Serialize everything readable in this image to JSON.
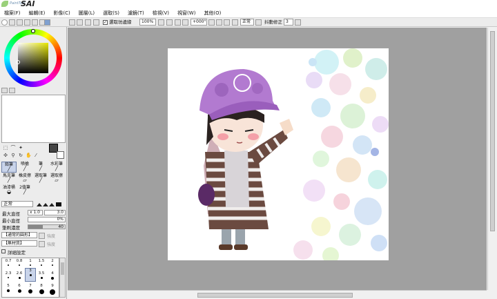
{
  "app": {
    "logo_small": "PaintTool",
    "logo_big": "SAI"
  },
  "menu": [
    "檔案(F)",
    "編輯(E)",
    "影像(C)",
    "圖層(L)",
    "選取(S)",
    "濾鏡(T)",
    "檢視(V)",
    "視窗(W)",
    "其他(O)"
  ],
  "toolbar": {
    "selection_checkbox_label": "選取坊邊緣",
    "zoom": "100%",
    "rotation": "+000°",
    "blend": "正常",
    "stabilizer_label": "抖動修正",
    "stabilizer_value": "3"
  },
  "brushes": [
    "鉛筆",
    "噴槍",
    "筆",
    "水彩筆",
    "馬克筆",
    "橡皮擦",
    "選取筆",
    "選取擦",
    "油漆桶",
    "2值筆"
  ],
  "brush_settings": {
    "mode": "正常",
    "max_size_label": "最大直徑",
    "max_size_mult": "x 1.0",
    "max_size_value": "3.0",
    "min_size_label": "最小直徑",
    "min_size_value": "0%",
    "density_label": "筆刷濃度",
    "density_value": "40",
    "density_fraction": 0.4,
    "shape_label": "【通常的圓形】",
    "texture_label": "【無材質】",
    "shape_strength": "強度",
    "texture_strength": "強度",
    "advanced_label": "詳細設定"
  },
  "brush_sizes": [
    "0.7",
    "0.8",
    "1",
    "1.5",
    "2",
    "2.3",
    "2.6",
    "3",
    "3.5",
    "4",
    "5",
    "6",
    "7",
    "8",
    "9"
  ],
  "selected_brush_size": "3",
  "colors": {
    "accent": "#6b7ea6",
    "main_color": "#444444",
    "sub_color": "#ffffff"
  }
}
